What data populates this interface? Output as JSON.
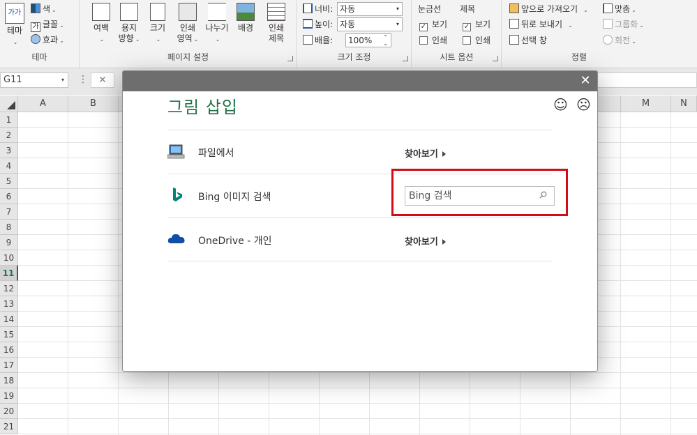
{
  "ribbon": {
    "theme_group": {
      "label": "테마",
      "theme_btn": "테마",
      "theme_icon_text": "가가",
      "colors": "색",
      "fonts": "글꼴",
      "effects": "효과"
    },
    "page_setup": {
      "label": "페이지 설정",
      "margins": "여백",
      "orientation_l1": "용지",
      "orientation_l2": "방향",
      "size": "크기",
      "print_area_l1": "인쇄",
      "print_area_l2": "영역",
      "breaks": "나누기",
      "background": "배경",
      "print_titles_l1": "인쇄",
      "print_titles_l2": "제목"
    },
    "scale": {
      "label": "크기 조정",
      "width_label": "너비:",
      "width_value": "자동",
      "height_label": "높이:",
      "height_value": "자동",
      "scale_label": "배율:",
      "scale_value": "100%"
    },
    "sheet_options": {
      "label": "시트 옵션",
      "gridlines": "눈금선",
      "headings": "제목",
      "view": "보기",
      "print": "인쇄"
    },
    "arrange": {
      "label": "정렬",
      "bring_forward": "앞으로 가져오기",
      "send_backward": "뒤로 보내기",
      "selection_pane": "선택 창",
      "align": "맞춤",
      "group": "그룹화",
      "rotate": "회전"
    }
  },
  "formula_bar": {
    "name_box": "G11",
    "cancel": "✕",
    "options": "⋮"
  },
  "columns": [
    "A",
    "B",
    "",
    "",
    "",
    "",
    "",
    "",
    "",
    "",
    "",
    "",
    "M",
    "N"
  ],
  "rows": [
    "1",
    "2",
    "3",
    "4",
    "5",
    "6",
    "7",
    "8",
    "9",
    "10",
    "11",
    "12",
    "13",
    "14",
    "15",
    "16",
    "17",
    "18",
    "19",
    "20",
    "21"
  ],
  "active_row": "11",
  "dialog": {
    "title": "그림 삽입",
    "close": "✕",
    "smile": "☺",
    "frown": "☹",
    "from_file": {
      "label": "파일에서",
      "action": "찾아보기"
    },
    "bing": {
      "label": "Bing 이미지 검색",
      "placeholder": "Bing 검색"
    },
    "onedrive": {
      "label": "OneDrive - 개인",
      "action": "찾아보기"
    }
  },
  "colors": {
    "accent_green": "#217346",
    "highlight_red": "#d50b12",
    "bing_teal": "#008373",
    "onedrive_blue": "#0f4fa8"
  }
}
